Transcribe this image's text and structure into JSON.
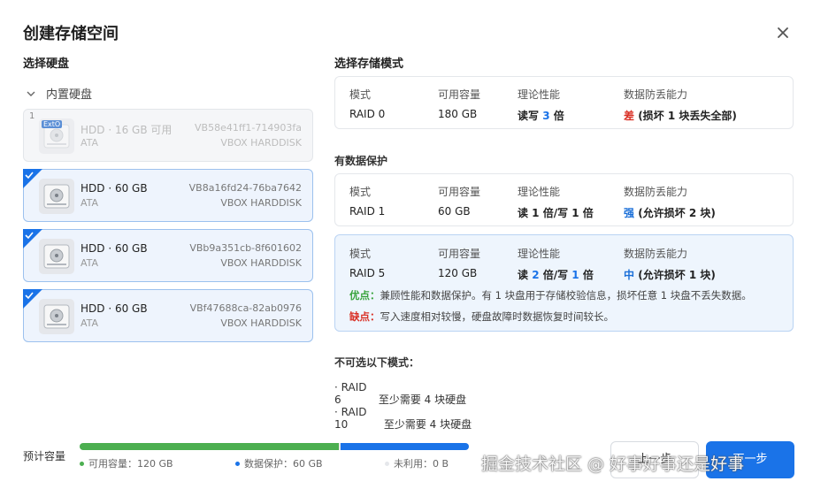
{
  "dialog": {
    "title": "创建存储空间",
    "close_icon": "close-icon"
  },
  "left": {
    "section_title": "选择硬盘",
    "group": "内置硬盘",
    "disks": [
      {
        "index": "1",
        "badge": "ExtO",
        "name": "HDD · 16 GB 可用",
        "vendor_sub": "ATA",
        "serial": "VB58e41ff1-714903fa",
        "model": "VBOX HARDDISK",
        "selected": false,
        "disabled": true
      },
      {
        "name": "HDD · 60 GB",
        "vendor_sub": "ATA",
        "serial": "VB8a16fd24-76ba7642",
        "model": "VBOX HARDDISK",
        "selected": true
      },
      {
        "name": "HDD · 60 GB",
        "vendor_sub": "ATA",
        "serial": "VBb9a351cb-8f601602",
        "model": "VBOX HARDDISK",
        "selected": true
      },
      {
        "name": "HDD · 60 GB",
        "vendor_sub": "ATA",
        "serial": "VBf47688ca-82ab0976",
        "model": "VBOX HARDDISK",
        "selected": true
      }
    ]
  },
  "right": {
    "section_title": "选择存储模式",
    "columns": [
      "模式",
      "可用容量",
      "理论性能",
      "数据防丢能力"
    ],
    "raid0": {
      "mode": "RAID 0",
      "capacity": "180 GB",
      "perf_a": "读写 ",
      "perf_n": "3",
      "perf_b": " 倍",
      "safety": "差",
      "safety_note": " (损坏 1 块丢失全部)"
    },
    "protect_title": "有数据保护",
    "raid1": {
      "mode": "RAID 1",
      "capacity": "60 GB",
      "perf": "读 1 倍/写 1 倍",
      "safety": "强",
      "safety_note": " (允许损坏 2 块)"
    },
    "raid5": {
      "mode": "RAID 5",
      "capacity": "120 GB",
      "perf_a": "读 ",
      "perf_n1": "2",
      "perf_b": " 倍/写 ",
      "perf_n2": "1",
      "perf_c": " 倍",
      "safety": "中",
      "safety_note": " (允许损坏 1 块)",
      "pros_label": "优点：",
      "pros": "兼顾性能和数据保护。有 1 块盘用于存储校验信息，损坏任意 1 块盘不丢失数据。",
      "cons_label": "缺点：",
      "cons": "写入速度相对较慢，硬盘故障时数据恢复时间较长。"
    },
    "unavailable_title": "不可选以下模式：",
    "unavailable": [
      {
        "mode": "· RAID 6",
        "reason": "至少需要 4 块硬盘"
      },
      {
        "mode": "· RAID 10",
        "reason": "至少需要 4 块硬盘"
      }
    ]
  },
  "footer": {
    "capacity_label": "预计容量",
    "usable_label": "可用容量：120 GB",
    "protect_label": "数据保护：60 GB",
    "unused_label": "未利用：0 B",
    "usable_value": 120,
    "protect_value": 60,
    "unused_value": 0,
    "colors": {
      "usable": "#4caf50",
      "protect": "#1a73e8",
      "unused": "#e5e7eb"
    },
    "prev_label": "上一步",
    "next_label": "下一步"
  },
  "watermark": "掘金技术社区 @ 好事好事还是好事"
}
